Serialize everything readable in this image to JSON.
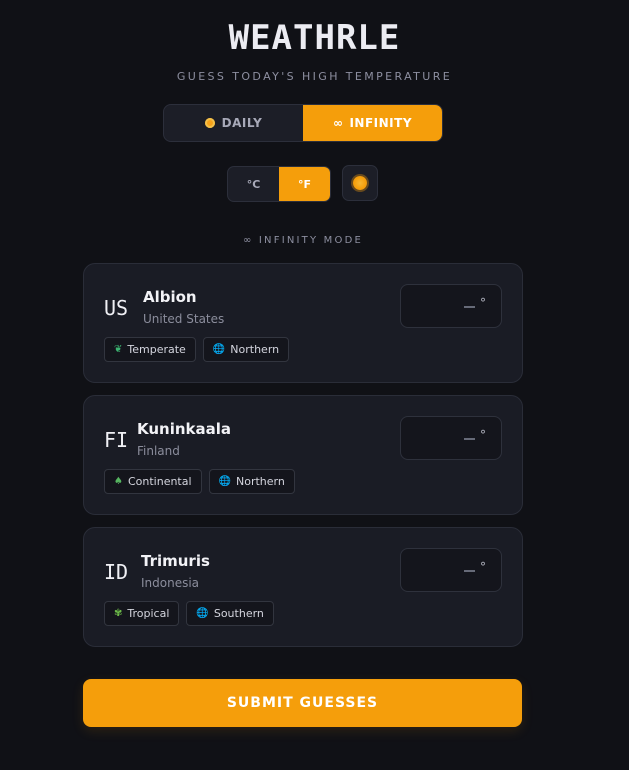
{
  "header": {
    "title": "WEATHRLE",
    "subtitle": "GUESS TODAY'S HIGH TEMPERATURE"
  },
  "mode_toggle": {
    "daily_label": "DAILY",
    "infinity_label": "INFINITY",
    "infinity_glyph": "∞",
    "active": "infinity"
  },
  "unit_toggle": {
    "celsius_label": "°C",
    "fahrenheit_label": "°F",
    "active": "fahrenheit"
  },
  "mode_label": "∞ INFINITY MODE",
  "cards": [
    {
      "code": "US",
      "name": "Albion",
      "country": "United States",
      "guess_value": "",
      "degree": "°",
      "tags": [
        {
          "icon": "leaf-icon",
          "glyph": "❦",
          "label": "Temperate"
        },
        {
          "icon": "globe-icon",
          "glyph": "🌐",
          "label": "Northern"
        }
      ]
    },
    {
      "code": "FI",
      "name": "Kuninkaala",
      "country": "Finland",
      "guess_value": "",
      "degree": "°",
      "tags": [
        {
          "icon": "tree-icon",
          "glyph": "♠",
          "label": "Continental"
        },
        {
          "icon": "globe-icon",
          "glyph": "🌐",
          "label": "Northern"
        }
      ]
    },
    {
      "code": "ID",
      "name": "Trimuris",
      "country": "Indonesia",
      "guess_value": "",
      "degree": "°",
      "tags": [
        {
          "icon": "palm-icon",
          "glyph": "✾",
          "label": "Tropical"
        },
        {
          "icon": "globe-icon",
          "glyph": "🌐",
          "label": "Southern"
        }
      ]
    }
  ],
  "submit_label": "SUBMIT GUESSES",
  "colors": {
    "accent": "#f59e0b",
    "background": "#101116",
    "card": "#1a1c25"
  }
}
